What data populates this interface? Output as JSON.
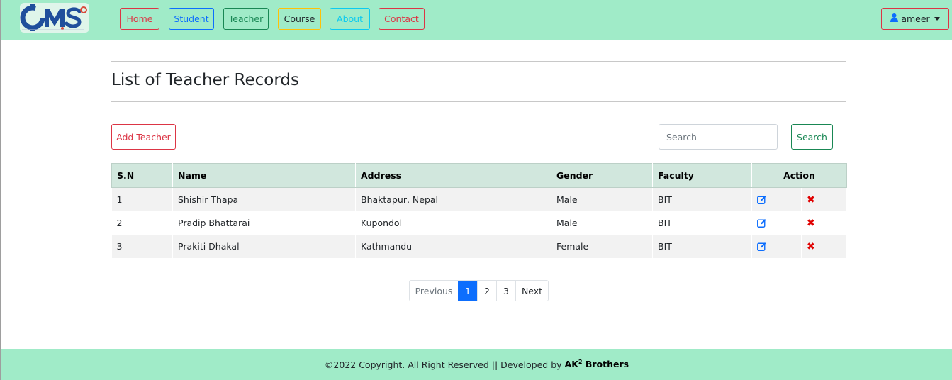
{
  "brand": {
    "logo_text": "CMS"
  },
  "nav": {
    "items": [
      {
        "label": "Home",
        "color": "#dc3545"
      },
      {
        "label": "Student",
        "color": "#0d6efd"
      },
      {
        "label": "Teacher",
        "color": "#198754"
      },
      {
        "label": "Course",
        "color": "#ffc107"
      },
      {
        "label": "About",
        "color": "#0dcaf0"
      },
      {
        "label": "Contact",
        "color": "#dc3545"
      }
    ],
    "active": "Teacher",
    "user": {
      "name": "ameer",
      "icon": "user-icon"
    }
  },
  "page": {
    "title": "List of Teacher Records",
    "add_button": "Add Teacher",
    "search": {
      "placeholder": "Search",
      "value": "",
      "button": "Search"
    }
  },
  "table": {
    "headers": [
      "S.N",
      "Name",
      "Address",
      "Gender",
      "Faculty",
      "Action"
    ],
    "rows": [
      {
        "sn": "1",
        "name": "Shishir Thapa",
        "address": "Bhaktapur, Nepal",
        "gender": "Male",
        "faculty": "BIT"
      },
      {
        "sn": "2",
        "name": "Pradip Bhattarai",
        "address": "Kupondol",
        "gender": "Male",
        "faculty": "BIT"
      },
      {
        "sn": "3",
        "name": "Prakiti Dhakal",
        "address": "Kathmandu",
        "gender": "Female",
        "faculty": "BIT"
      }
    ],
    "actions": {
      "edit_icon": "edit-icon",
      "delete_icon": "delete-icon"
    }
  },
  "pagination": {
    "previous": "Previous",
    "pages": [
      "1",
      "2",
      "3"
    ],
    "current": "1",
    "next": "Next"
  },
  "footer": {
    "text": "©2022 Copyright. All Right Reserved || Developed by",
    "brand_prefix": "AK",
    "brand_sup": "2",
    "brand_suffix": " Brothers"
  },
  "colors": {
    "header_bg": "#a0ebc8",
    "table_head_bg": "#d1e7dd",
    "accent_blue": "#0d6efd",
    "danger": "#dc3545"
  }
}
